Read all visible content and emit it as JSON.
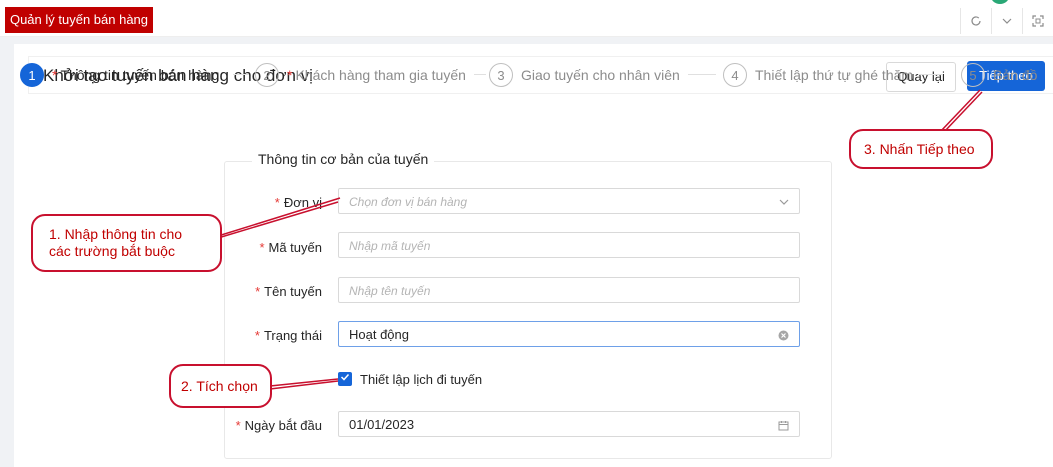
{
  "app_tab": "Quản lý tuyến bán hàng",
  "top_icons": [
    "refresh-icon",
    "chevron-down-icon",
    "fullscreen-icon"
  ],
  "page": {
    "title": "Khởi tạo tuyến bán hàng cho đơn vị",
    "back_label": "Quay lại",
    "next_label": "Tiếp theo"
  },
  "steps": [
    {
      "num": "1",
      "required": "*",
      "label": "Thông tin tuyến bán hàng"
    },
    {
      "num": "2",
      "required": "*",
      "label": "Khách hàng tham gia tuyến"
    },
    {
      "num": "3",
      "required": "",
      "label": "Giao tuyến cho nhân viên"
    },
    {
      "num": "4",
      "required": "",
      "label": "Thiết lập thứ tự ghé thăm"
    },
    {
      "num": "5",
      "required": "",
      "label": "Bản đồ"
    }
  ],
  "form": {
    "legend": "Thông tin cơ bản của tuyến",
    "required_mark": "*",
    "don_vi": {
      "label": "Đơn vị",
      "placeholder": "Chọn đơn vị bán hàng"
    },
    "ma_tuyen": {
      "label": "Mã tuyến",
      "placeholder": "Nhập mã tuyến"
    },
    "ten_tuyen": {
      "label": "Tên tuyến",
      "placeholder": "Nhập tên tuyến"
    },
    "trang_thai": {
      "label": "Trạng thái",
      "value": "Hoạt động"
    },
    "lich_di_tuyen": {
      "label": "Thiết lập lịch đi tuyến",
      "checked": true
    },
    "ngay_bat_dau": {
      "label": "Ngày bắt đầu",
      "value": "01/01/2023"
    }
  },
  "annotations": {
    "a1_line1": "1. Nhập thông tin cho",
    "a1_line2": "các trường bắt buộc",
    "a2": "2. Tích chọn",
    "a3": "3. Nhấn Tiếp theo"
  },
  "colors": {
    "brand_red": "#c00000",
    "primary": "#1565d8",
    "annotation": "#c8102e"
  }
}
